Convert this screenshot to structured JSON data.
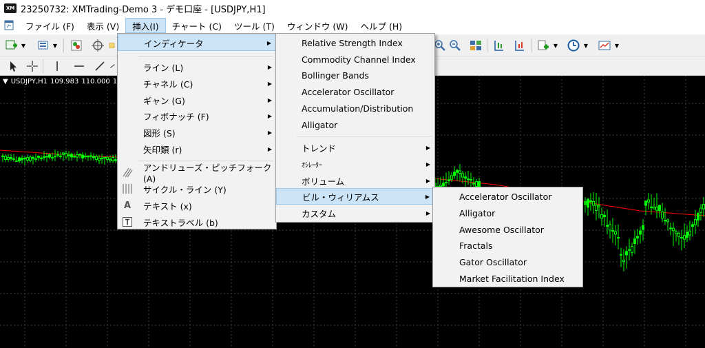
{
  "window": {
    "title": "23250732: XMTrading-Demo 3 - デモ口座 - [USDJPY,H1]",
    "logo": "XM"
  },
  "menubar": {
    "items": [
      {
        "label": "ファイル (F)",
        "active": false
      },
      {
        "label": "表示 (V)",
        "active": false
      },
      {
        "label": "挿入(I)",
        "active": true
      },
      {
        "label": "チャート (C)",
        "active": false
      },
      {
        "label": "ツール (T)",
        "active": false
      },
      {
        "label": "ウィンドウ (W)",
        "active": false
      },
      {
        "label": "ヘルプ (H)",
        "active": false
      }
    ]
  },
  "chart": {
    "symbol": "USDJPY,H1",
    "price1": "109.983",
    "price2": "110.000",
    "price3": "1",
    "background": "#000000",
    "candle_color": "#00ff00",
    "ma_color": "#ff0000",
    "grid_color": "#404040"
  },
  "insert_menu": {
    "items": [
      {
        "label": "インディケータ",
        "submenu": true,
        "highlighted": true,
        "icon": ""
      },
      {
        "label": "ライン (L)",
        "submenu": true,
        "icon": ""
      },
      {
        "label": "チャネル (C)",
        "submenu": true,
        "icon": ""
      },
      {
        "label": "ギャン (G)",
        "submenu": true,
        "icon": ""
      },
      {
        "label": "フィボナッチ (F)",
        "submenu": true,
        "icon": ""
      },
      {
        "label": "図形 (S)",
        "submenu": true,
        "icon": ""
      },
      {
        "label": "矢印類 (r)",
        "submenu": true,
        "icon": ""
      },
      {
        "label": "アンドリューズ・ピッチフォーク (A)",
        "submenu": false,
        "icon": "pitchfork-icon"
      },
      {
        "label": "サイクル・ライン (Y)",
        "submenu": false,
        "icon": "cycle-lines-icon"
      },
      {
        "label": "テキスト (x)",
        "submenu": false,
        "icon": "text-icon"
      },
      {
        "label": "テキストラベル (b)",
        "submenu": false,
        "icon": "text-label-icon"
      }
    ]
  },
  "indicators_menu": {
    "items": [
      {
        "label": "Relative Strength Index",
        "submenu": false
      },
      {
        "label": "Commodity Channel Index",
        "submenu": false
      },
      {
        "label": "Bollinger Bands",
        "submenu": false
      },
      {
        "label": "Accelerator Oscillator",
        "submenu": false
      },
      {
        "label": "Accumulation/Distribution",
        "submenu": false
      },
      {
        "label": "Alligator",
        "submenu": false
      },
      {
        "label": "トレンド",
        "submenu": true
      },
      {
        "label": "ｵｼﾚｰﾀｰ",
        "submenu": true
      },
      {
        "label": "ボリューム",
        "submenu": true
      },
      {
        "label": "ビル・ウィリアムス",
        "submenu": true,
        "highlighted": true
      },
      {
        "label": "カスタム",
        "submenu": true
      }
    ]
  },
  "bill_williams_menu": {
    "items": [
      {
        "label": "Accelerator Oscillator"
      },
      {
        "label": "Alligator"
      },
      {
        "label": "Awesome Oscillator"
      },
      {
        "label": "Fractals"
      },
      {
        "label": "Gator Oscillator"
      },
      {
        "label": "Market Facilitation Index"
      }
    ]
  }
}
